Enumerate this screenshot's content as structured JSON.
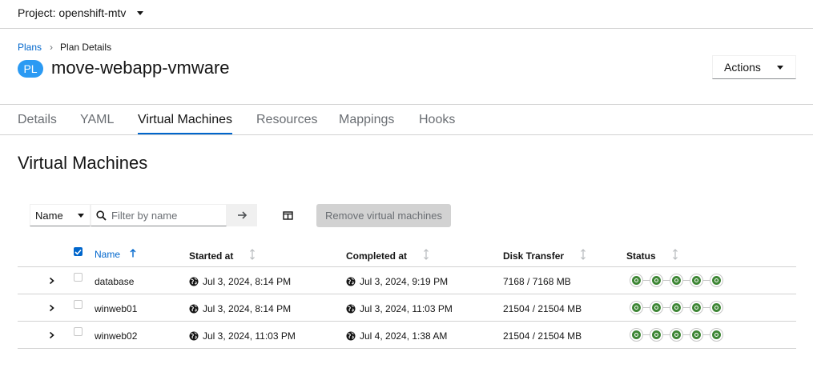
{
  "project": {
    "label": "Project: openshift-mtv"
  },
  "breadcrumb": {
    "root": "Plans",
    "separator": "›",
    "current": "Plan Details"
  },
  "header": {
    "badge": "PL",
    "title": "move-webapp-vmware",
    "actions_label": "Actions"
  },
  "tabs": [
    {
      "label": "Details"
    },
    {
      "label": "YAML"
    },
    {
      "label": "Virtual Machines",
      "active": true
    },
    {
      "label": "Resources"
    },
    {
      "label": "Mappings"
    },
    {
      "label": "Hooks"
    }
  ],
  "section": {
    "title": "Virtual Machines"
  },
  "toolbar": {
    "filter_attribute": "Name",
    "filter_placeholder": "Filter by name",
    "remove_label": "Remove virtual machines"
  },
  "table": {
    "columns": [
      {
        "label": "Name",
        "sorted": "ascending"
      },
      {
        "label": "Started at"
      },
      {
        "label": "Completed at"
      },
      {
        "label": "Disk Transfer"
      },
      {
        "label": "Status"
      }
    ],
    "rows": [
      {
        "name": "database",
        "started": "Jul 3, 2024, 8:14 PM",
        "completed": "Jul 3, 2024, 9:19 PM",
        "disk": "7168 / 7168 MB",
        "steps_done": 5,
        "steps_total": 5
      },
      {
        "name": "winweb01",
        "started": "Jul 3, 2024, 8:14 PM",
        "completed": "Jul 3, 2024, 11:03 PM",
        "disk": "21504 / 21504 MB",
        "steps_done": 5,
        "steps_total": 5
      },
      {
        "name": "winweb02",
        "started": "Jul 3, 2024, 11:03 PM",
        "completed": "Jul 4, 2024, 1:38 AM",
        "disk": "21504 / 21504 MB",
        "steps_done": 5,
        "steps_total": 5
      }
    ]
  },
  "colors": {
    "accent": "#0066cc",
    "badge": "#2b9af3",
    "success": "#3e8635"
  }
}
